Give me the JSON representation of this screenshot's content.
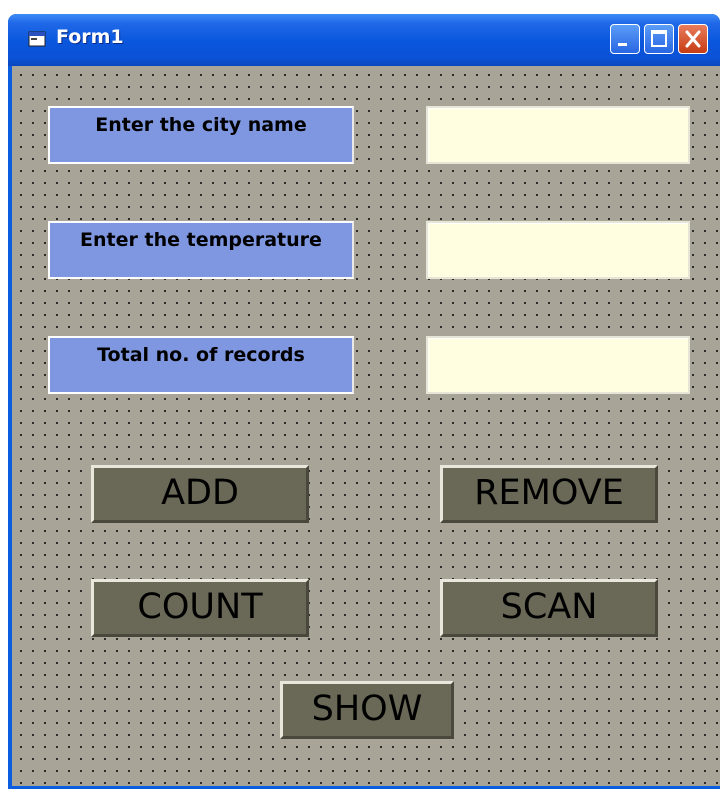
{
  "window": {
    "title": "Form1",
    "controls": [
      "minimize",
      "maximize",
      "close"
    ]
  },
  "labels": {
    "city": "Enter the city name",
    "temperature": "Enter the temperature",
    "records": "Total no. of records"
  },
  "inputs": {
    "city": "",
    "temperature": "",
    "records": ""
  },
  "buttons": {
    "add": "ADD",
    "remove": "REMOVE",
    "count": "COUNT",
    "scan": "SCAN",
    "show": "SHOW"
  },
  "colors": {
    "title_bar": "#0a56dc",
    "form_background": "#a8a497",
    "label_background": "#7f97e0",
    "textbox_background": "#fffee0",
    "button_background": "#6a6857",
    "close_button": "#c63c14"
  }
}
